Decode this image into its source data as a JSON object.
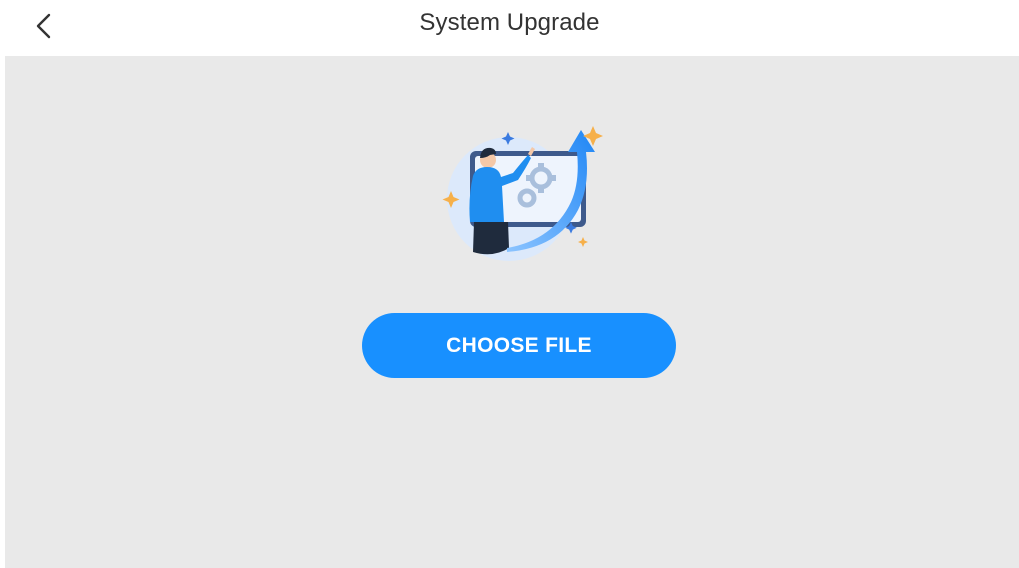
{
  "header": {
    "title": "System Upgrade",
    "back_icon": "chevron-left-icon"
  },
  "main": {
    "illustration": "upgrade-illustration",
    "choose_file_label": "CHOOSE FILE"
  },
  "colors": {
    "accent": "#1890ff",
    "content_bg": "#e9e9e9",
    "header_bg": "#ffffff",
    "title_text": "#333333"
  }
}
